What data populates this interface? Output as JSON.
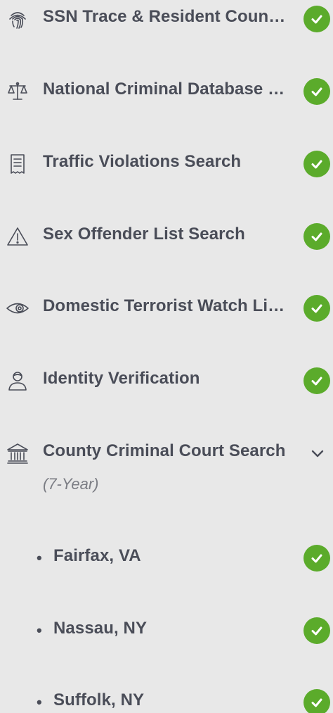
{
  "colors": {
    "background": "#e8e8e8",
    "text": "#4a4d58",
    "check_green": "#5bab2b",
    "icon_stroke": "#4a4d58"
  },
  "checks": [
    {
      "label": "SSN Trace & Resident County Search",
      "icon": "fingerprint-icon",
      "status": "complete"
    },
    {
      "label": "National Criminal Database Search",
      "icon": "scales-icon",
      "status": "complete"
    },
    {
      "label": "Traffic Violations Search",
      "icon": "receipt-icon",
      "status": "complete"
    },
    {
      "label": "Sex Offender List Search",
      "icon": "warning-icon",
      "status": "complete"
    },
    {
      "label": "Domestic Terrorist Watch List Search",
      "icon": "eye-icon",
      "status": "complete"
    },
    {
      "label": "Identity Verification",
      "icon": "user-icon",
      "status": "complete"
    },
    {
      "label": "County Criminal Court Search",
      "icon": "courthouse-icon",
      "status": "expanded",
      "sublabel": "(7-Year)"
    }
  ],
  "counties": [
    {
      "bullet": "•",
      "label": "Fairfax, VA",
      "status": "complete"
    },
    {
      "bullet": "•",
      "label": "Nassau, NY",
      "status": "complete"
    },
    {
      "bullet": "•",
      "label": "Suffolk, NY",
      "status": "complete"
    }
  ]
}
